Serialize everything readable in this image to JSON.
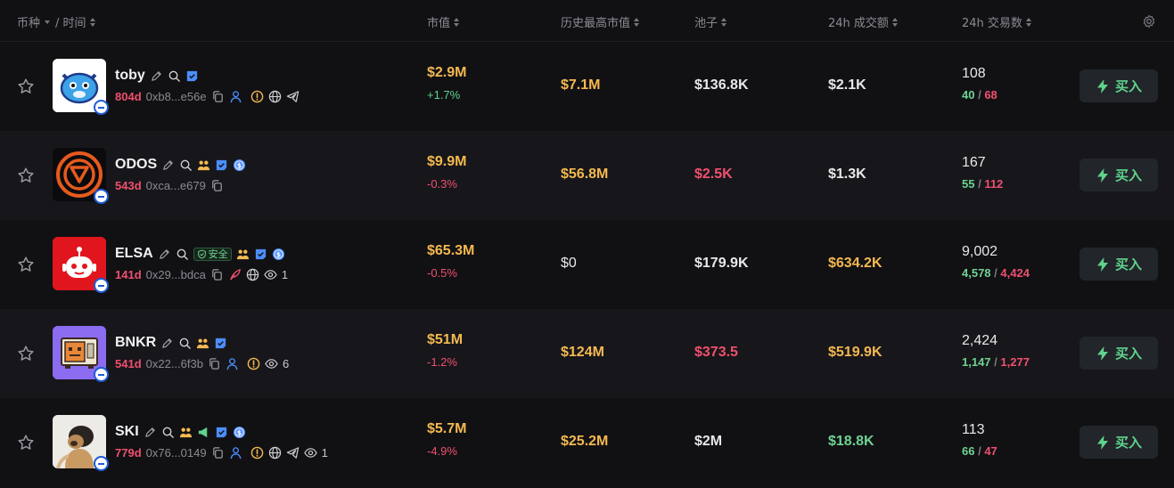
{
  "header": {
    "token": "币种",
    "time": "/ 时间",
    "mcap": "市值",
    "ath": "历史最高市值",
    "pool": "池子",
    "vol": "24h 成交额",
    "txns": "24h 交易数"
  },
  "colors": {
    "accent_green": "#5fd38d",
    "accent_red": "#f0506e",
    "accent_gold": "#f5b950",
    "bg": "#111114"
  },
  "rows": [
    {
      "symbol": "toby",
      "age": "804d",
      "address": "0xb8...e56e",
      "mcap": "$2.9M",
      "change": "+1.7%",
      "ath": "$7.1M",
      "pool": "$136.8K",
      "vol": "$2.1K",
      "txns": "108",
      "buys": "40",
      "sells": "68",
      "buy_label": "买入"
    },
    {
      "symbol": "ODOS",
      "age": "543d",
      "address": "0xca...e679",
      "mcap": "$9.9M",
      "change": "-0.3%",
      "ath": "$56.8M",
      "pool": "$2.5K",
      "vol": "$1.3K",
      "txns": "167",
      "buys": "55",
      "sells": "112",
      "buy_label": "买入"
    },
    {
      "symbol": "ELSA",
      "safe_label": "安全",
      "age": "141d",
      "address": "0x29...bdca",
      "views": "1",
      "mcap": "$65.3M",
      "change": "-0.5%",
      "ath": "$0",
      "pool": "$179.9K",
      "vol": "$634.2K",
      "txns": "9,002",
      "buys": "4,578",
      "sells": "4,424",
      "buy_label": "买入"
    },
    {
      "symbol": "BNKR",
      "age": "541d",
      "address": "0x22...6f3b",
      "views": "6",
      "mcap": "$51M",
      "change": "-1.2%",
      "ath": "$124M",
      "pool": "$373.5",
      "vol": "$519.9K",
      "txns": "2,424",
      "buys": "1,147",
      "sells": "1,277",
      "buy_label": "买入"
    },
    {
      "symbol": "SKI",
      "age": "779d",
      "address": "0x76...0149",
      "views": "1",
      "mcap": "$5.7M",
      "change": "-4.9%",
      "ath": "$25.2M",
      "pool": "$2M",
      "vol": "$18.8K",
      "txns": "113",
      "buys": "66",
      "sells": "47",
      "buy_label": "买入"
    }
  ]
}
